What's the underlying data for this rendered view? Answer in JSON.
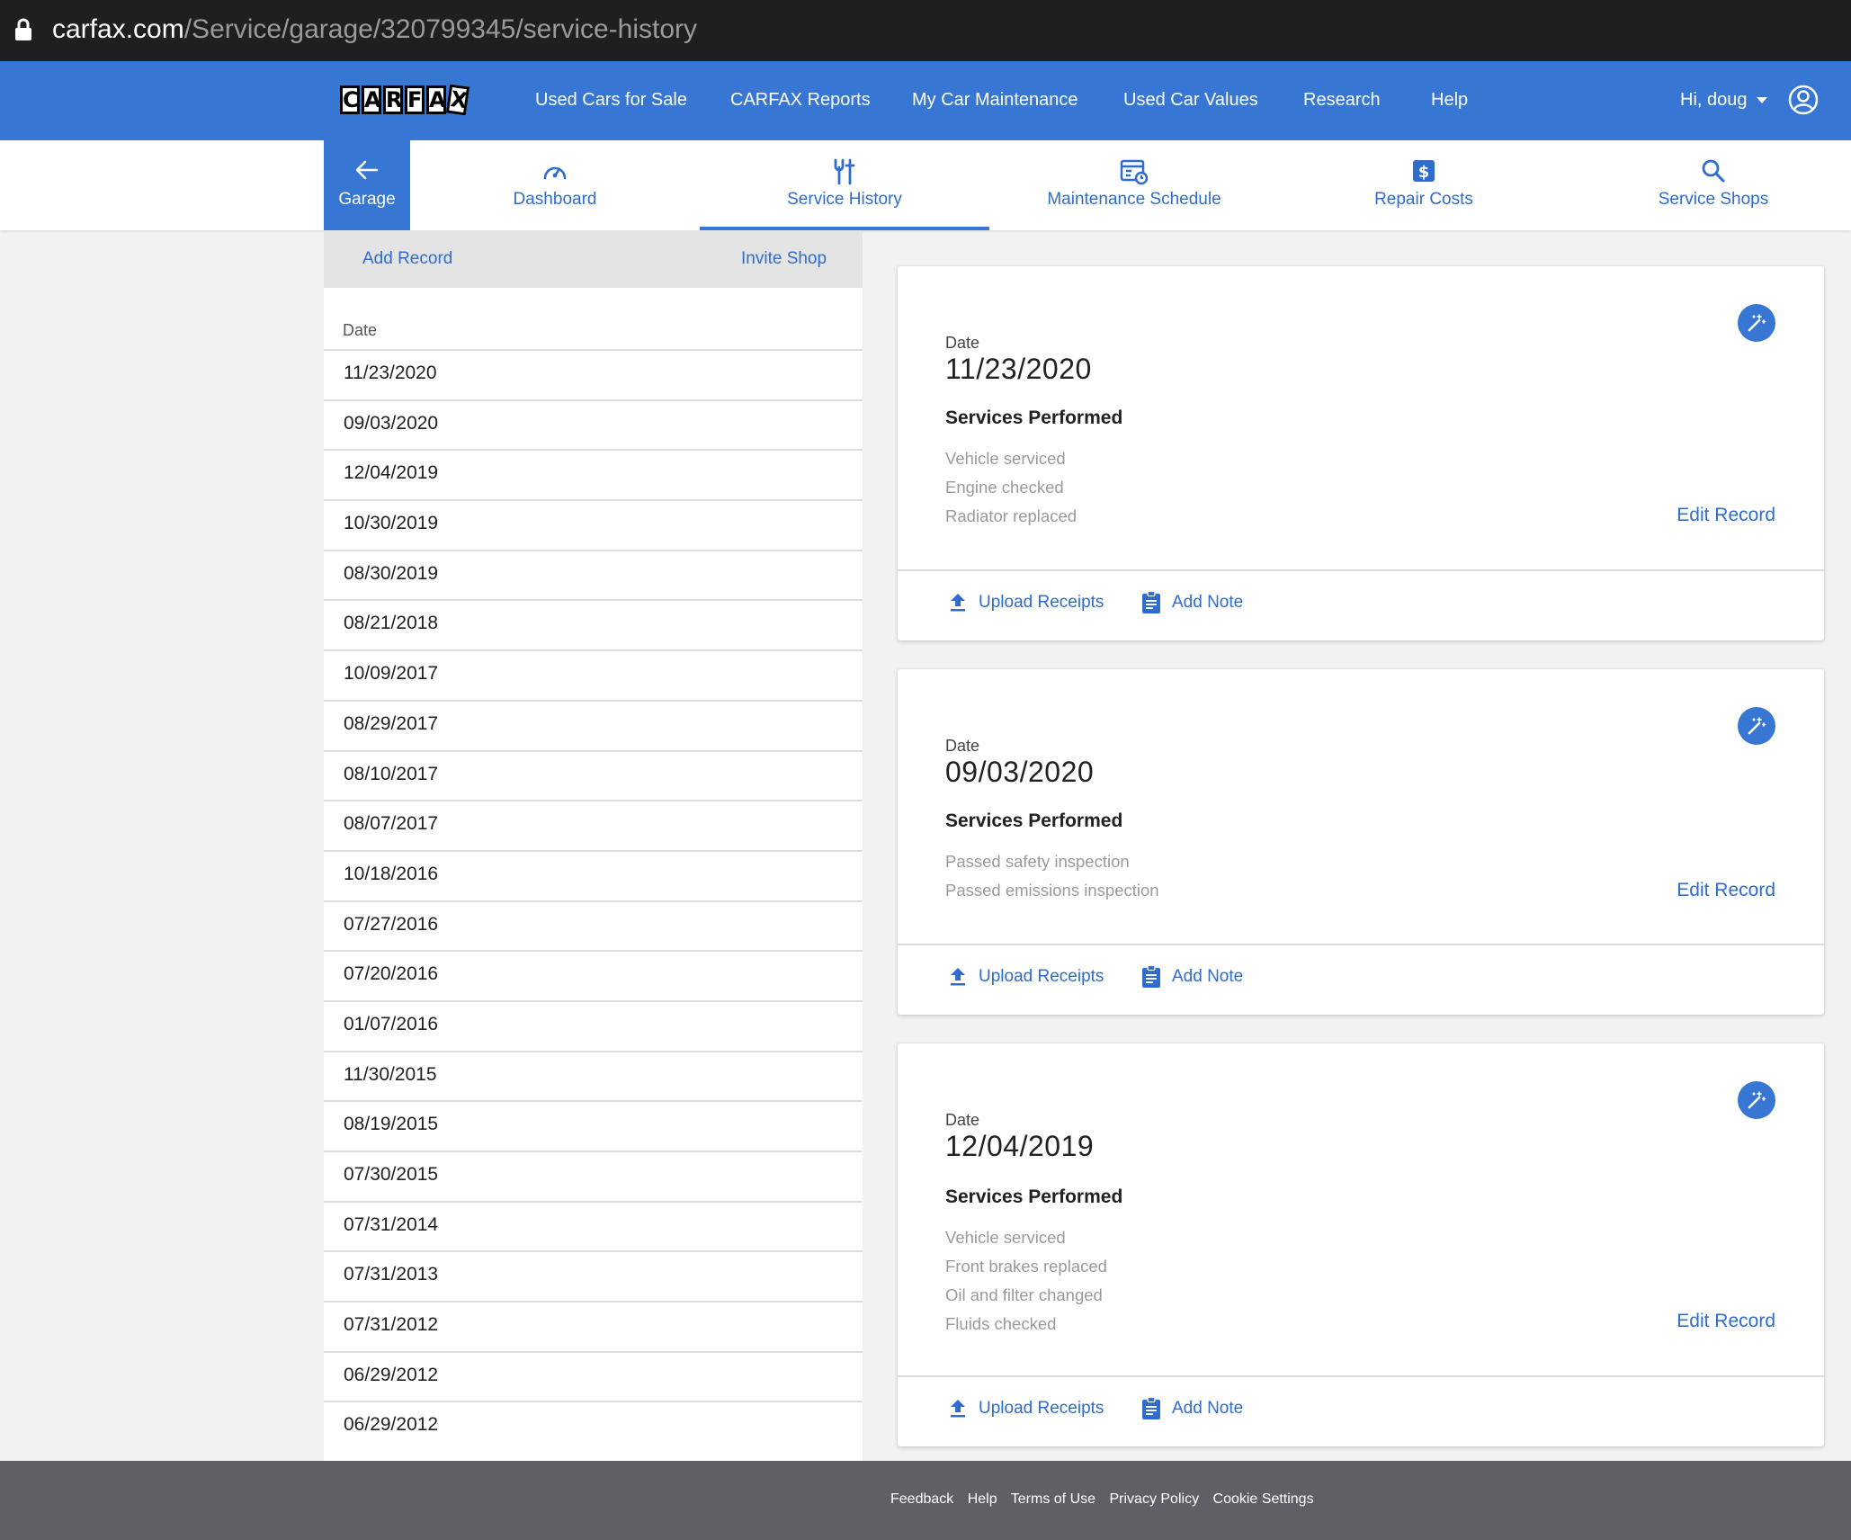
{
  "browser": {
    "url_host": "carfax.com",
    "url_path": "/Service/garage/320799345/service-history"
  },
  "topnav": {
    "logo_letters": [
      "C",
      "A",
      "R",
      "F",
      "A",
      "X"
    ],
    "links": [
      "Used Cars for Sale",
      "CARFAX Reports",
      "My Car Maintenance",
      "Used Car Values",
      "Research",
      "Help"
    ],
    "user_greeting": "Hi, doug"
  },
  "subnav": {
    "back_label": "Garage",
    "tabs": [
      "Dashboard",
      "Service History",
      "Maintenance Schedule",
      "Repair Costs",
      "Service Shops"
    ],
    "active_tab": "Service History"
  },
  "record_list": {
    "add_record": "Add Record",
    "invite_shop": "Invite Shop",
    "date_header": "Date",
    "dates": [
      "11/23/2020",
      "09/03/2020",
      "12/04/2019",
      "10/30/2019",
      "08/30/2019",
      "08/21/2018",
      "10/09/2017",
      "08/29/2017",
      "08/10/2017",
      "08/07/2017",
      "10/18/2016",
      "07/27/2016",
      "07/20/2016",
      "01/07/2016",
      "11/30/2015",
      "08/19/2015",
      "07/30/2015",
      "07/31/2014",
      "07/31/2013",
      "07/31/2012",
      "06/29/2012",
      "06/29/2012"
    ]
  },
  "records": [
    {
      "date_label": "Date",
      "date": "11/23/2020",
      "services_title": "Services Performed",
      "services": [
        "Vehicle serviced",
        "Engine checked",
        "Radiator replaced"
      ],
      "edit_label": "Edit Record",
      "upload_label": "Upload Receipts",
      "note_label": "Add Note"
    },
    {
      "date_label": "Date",
      "date": "09/03/2020",
      "services_title": "Services Performed",
      "services": [
        "Passed safety inspection",
        "Passed emissions inspection"
      ],
      "edit_label": "Edit Record",
      "upload_label": "Upload Receipts",
      "note_label": "Add Note"
    },
    {
      "date_label": "Date",
      "date": "12/04/2019",
      "services_title": "Services Performed",
      "services": [
        "Vehicle serviced",
        "Front brakes replaced",
        "Oil and filter changed",
        "Fluids checked"
      ],
      "edit_label": "Edit Record",
      "upload_label": "Upload Receipts",
      "note_label": "Add Note"
    }
  ],
  "footer": {
    "links": [
      "Feedback",
      "Help",
      "Terms of Use",
      "Privacy Policy",
      "Cookie Settings"
    ]
  },
  "colors": {
    "brand_blue": "#3777d3",
    "link_blue": "#2f6ccc",
    "footer_gray": "#5f6065"
  }
}
